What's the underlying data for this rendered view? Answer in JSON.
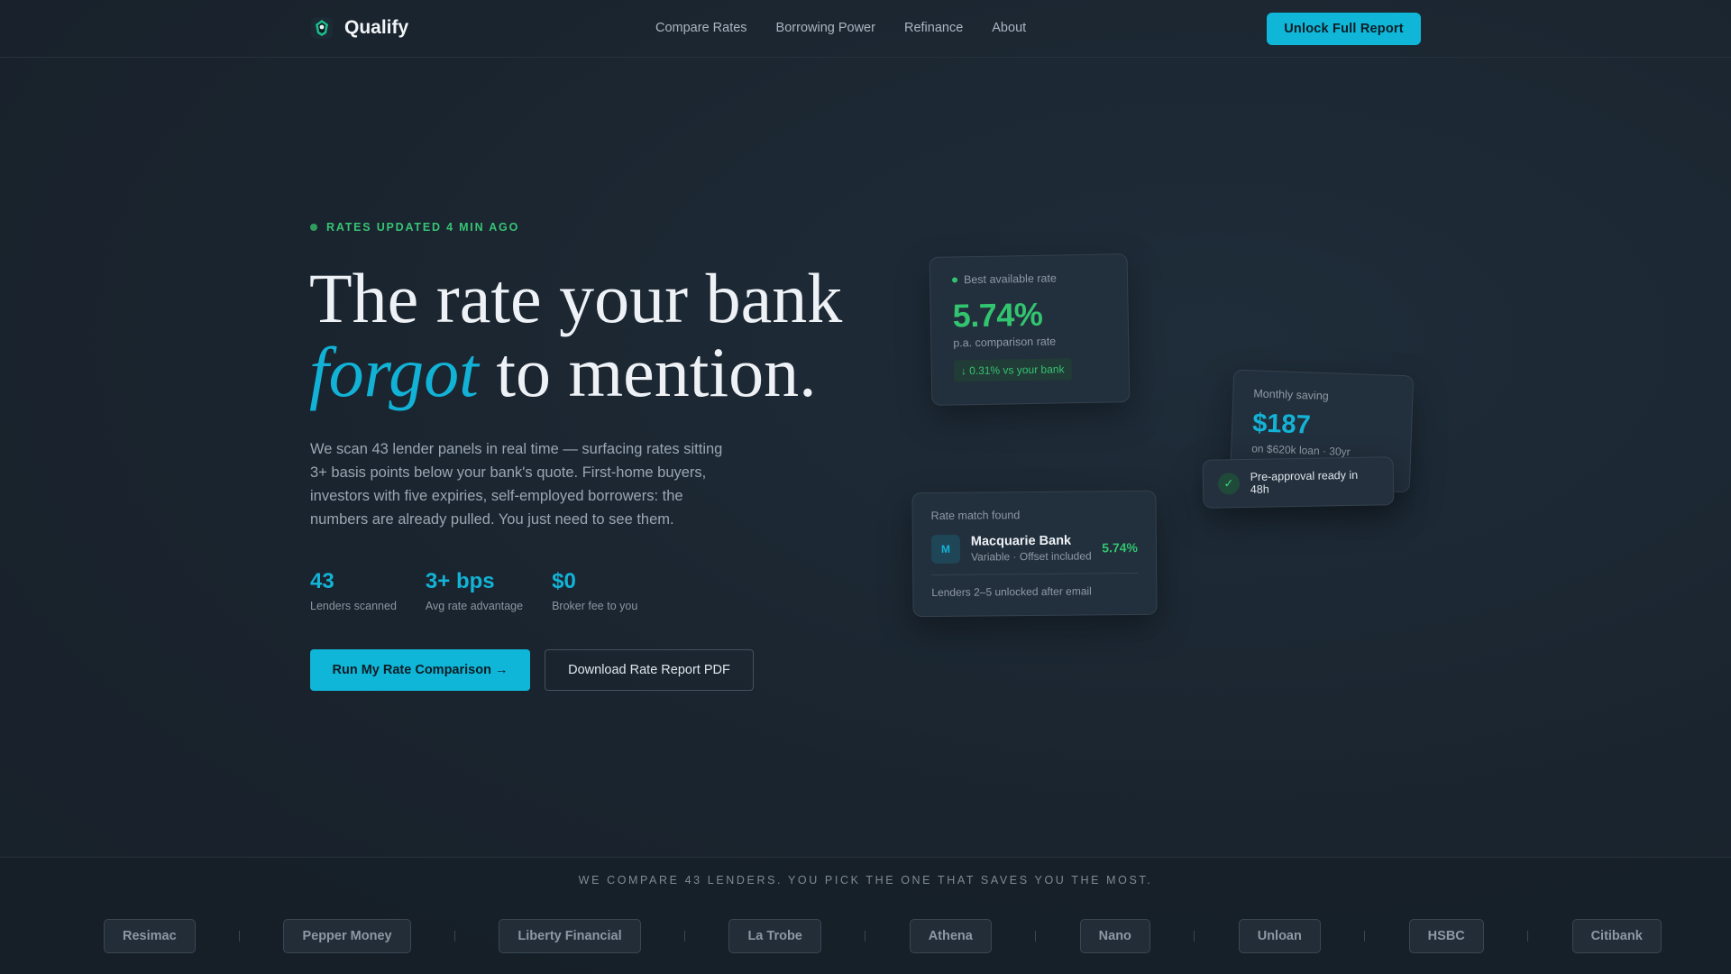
{
  "nav": {
    "brand": "Qualify",
    "links": [
      "Compare Rates",
      "Borrowing Power",
      "Refinance",
      "About"
    ],
    "cta": "Unlock Full Report"
  },
  "hero": {
    "status": "RATES UPDATED 4 MIN AGO",
    "headline_line1": "The rate your bank",
    "headline_accent": "forgot",
    "headline_rest": " to mention.",
    "lead": "We scan 43 lender panels in real time — surfacing rates sitting 3+ basis points below your bank's quote. First-home buyers, investors with five expiries, self-employed borrowers: the numbers are already pulled. You just need to see them.",
    "stats": [
      {
        "value": "43",
        "label": "Lenders scanned"
      },
      {
        "value": "3+ bps",
        "label": "Avg rate advantage"
      },
      {
        "value": "$0",
        "label": "Broker fee to you"
      }
    ],
    "primary_button": "Run My Rate Comparison →",
    "secondary_button": "Download Rate Report PDF"
  },
  "cards": {
    "rate": {
      "label": "Best available rate",
      "value": "5.74%",
      "sub": "p.a. comparison rate",
      "badge": "↓ 0.31% vs your bank"
    },
    "saving": {
      "label": "Monthly saving",
      "value": "$187",
      "sub": "on $620k loan · 30yr"
    },
    "preapproval": {
      "text": "Pre-approval ready in 48h"
    },
    "match": {
      "label": "Rate match found",
      "avatar": "M",
      "lender": "Macquarie Bank",
      "detail": "Variable · Offset included",
      "rate": "5.74%",
      "footer": "Lenders 2–5 unlocked after email"
    }
  },
  "strip": {
    "title": "WE COMPARE 43 LENDERS.  YOU PICK THE ONE THAT SAVES YOU THE MOST.",
    "lenders": [
      "Resimac",
      "Pepper Money",
      "Liberty Financial",
      "La Trobe",
      "Athena",
      "Nano",
      "Unloan",
      "HSBC",
      "Citibank"
    ]
  },
  "colors": {
    "accent": "#0fb6d8",
    "positive": "#32c46f",
    "background": "#1a232d"
  }
}
